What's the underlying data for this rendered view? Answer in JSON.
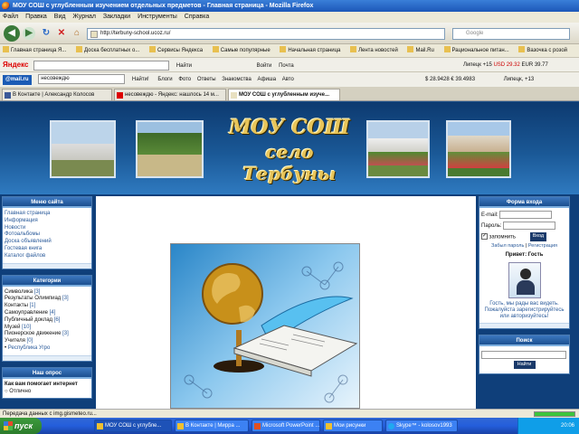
{
  "browser": {
    "title": "МОУ СОШ с углубленным изучением отдельных предметов - Главная страница - Mozilla Firefox",
    "menu": [
      "Файл",
      "Правка",
      "Вид",
      "Журнал",
      "Закладки",
      "Инструменты",
      "Справка"
    ],
    "url": "http://terbuny-school.ucoz.ru/",
    "search_placeholder": "Google"
  },
  "bookmarks": [
    "Главная страница Я...",
    "Доска бесплатных о...",
    "Сервисы Яндекса",
    "Самые популярные",
    "Начальная страница",
    "Лента новостей",
    "Mail.Ru",
    "Рациональное питан...",
    "Вазочка с розой"
  ],
  "yandex_bar": {
    "logo": "Яндекс",
    "find": "Найти",
    "login": "Войти",
    "mail": "Почта",
    "weather": "Липецк",
    "temp": "+15",
    "usd": "USD 29.32",
    "eur": "EUR 39.77"
  },
  "mail_bar": {
    "logo": "@mail.ru",
    "query": "несовеждю",
    "find": "Найти!",
    "items": [
      "Блоги",
      "Фото",
      "Ответы",
      "Знакомства",
      "Афиша",
      "Авто"
    ],
    "rates": "$ 28.9428 € 39.4983",
    "weather": "Липецк, +13"
  },
  "tabs": [
    "В Контакте | Александр Колосов",
    "несовеждю - Яндекс: нашлось 14 м...",
    "МОУ СОШ с углубленным изуче..."
  ],
  "site": {
    "logo_line1": "МОУ СОШ",
    "logo_line2": "село Тербуны",
    "menu_title": "Меню сайта",
    "menu_items": [
      "Главная страница",
      "Информация",
      "Новости",
      "Фотоальбомы",
      "Доска объявлений",
      "Гостевая книга",
      "Каталог файлов"
    ],
    "categories_title": "Категории",
    "categories": [
      {
        "name": "Символика",
        "count": "[3]"
      },
      {
        "name": "Результаты Олимпиад",
        "count": "[3]"
      },
      {
        "name": "Контакты",
        "count": "[1]"
      },
      {
        "name": "Самоуправление",
        "count": "[4]"
      },
      {
        "name": "Публичный доклад",
        "count": "[6]"
      },
      {
        "name": "Музей",
        "count": "[10]"
      },
      {
        "name": "Пионерское движение",
        "count": "[3]"
      },
      {
        "name": "Учителя",
        "count": "[0]"
      },
      {
        "name": "Республика Угро",
        "count": ""
      }
    ],
    "poll_title": "Наш опрос",
    "poll_question": "Как вам помогает интернет",
    "poll_option": "Отлично",
    "login_title": "Форма входа",
    "email_label": "E-mail:",
    "password_label": "Пароль:",
    "remember": "запомнить",
    "login_button": "Вход",
    "forgot": "Забыл пароль",
    "register": "Регистрация",
    "greeting": "Привет: Гость",
    "guest_text": "Гость, мы рады вас видеть. Пожалуйста зарегистрируйтесь или авторизуйтесь!",
    "search_title": "Поиск",
    "search_button": "Найти"
  },
  "status": "Передача данных с img.gismeteo.ru...",
  "taskbar": {
    "start": "пуск",
    "tasks": [
      "МОУ СОШ с углубле...",
      "В Контакте | Мирра ...",
      "Microsoft PowerPoint ...",
      "Мои рисунки",
      "Skype™ - kolosov1993"
    ],
    "time": "20:06"
  }
}
